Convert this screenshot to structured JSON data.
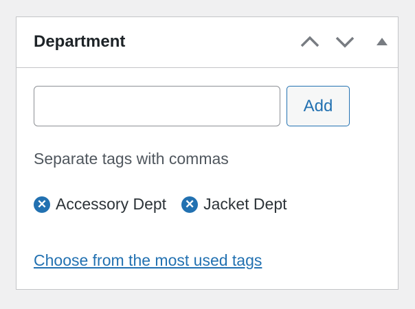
{
  "panel": {
    "title": "Department",
    "add_label": "Add",
    "input_value": "",
    "hint": "Separate tags with commas",
    "tags": [
      "Accessory Dept",
      "Jacket Dept"
    ],
    "link": "Choose from the most used tags"
  }
}
